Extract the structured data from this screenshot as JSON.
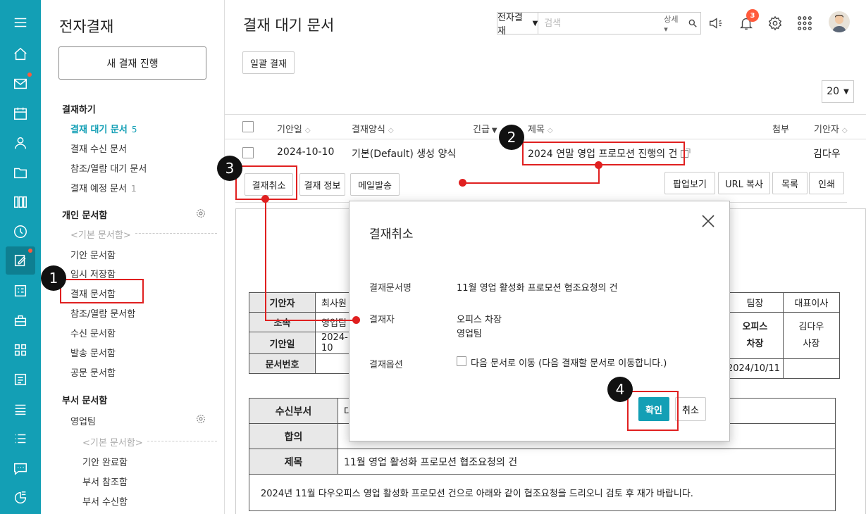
{
  "sidebar": {
    "title": "전자결재",
    "new_button": "새 결재 진행",
    "sections": {
      "approve": "결재하기",
      "personal": "개인 문서함",
      "dept": "부서 문서함"
    },
    "approve_items": [
      {
        "label": "결재 대기 문서",
        "count": "5"
      },
      {
        "label": "결재 수신 문서"
      },
      {
        "label": "참조/열람 대기 문서"
      },
      {
        "label": "결재 예정 문서",
        "count": "1"
      }
    ],
    "personal_group": "<기본 문서함>",
    "personal_items": [
      "기안 문서함",
      "임시 저장함",
      "결재 문서함",
      "참조/열람 문서함",
      "수신 문서함",
      "발송 문서함",
      "공문 문서함"
    ],
    "dept_team": "영업팀",
    "dept_group": "<기본 문서함>",
    "dept_items": [
      "기안 완료함",
      "부서 참조함",
      "부서 수신함"
    ]
  },
  "header": {
    "title": "결재 대기 문서",
    "search_scope": "전자결재",
    "search_placeholder": "검색",
    "advanced": "상세",
    "notification_count": "3"
  },
  "toolbar": {
    "bulk_approve": "일괄 결재",
    "per_page": "20"
  },
  "table": {
    "headers": {
      "date": "기안일",
      "form": "결재양식",
      "urgent": "긴급",
      "title": "제목",
      "attach": "첨부",
      "drafter": "기안자"
    },
    "row": {
      "date": "2024-10-10",
      "form": "기본(Default) 생성 양식",
      "title": "2024 연말 영업 프로모션 진행의 건",
      "drafter": "김다우"
    }
  },
  "actions": {
    "cancel_approval": "결재취소",
    "approval_info": "결재 정보",
    "send_mail": "메일발송",
    "popup": "팝업보기",
    "copy_url": "URL 복사",
    "list": "목록",
    "print": "인쇄"
  },
  "document": {
    "info_labels": [
      "기안자",
      "소속",
      "기안일",
      "문서번호"
    ],
    "info_values": [
      "최사원",
      "영업팀",
      "2024-10"
    ],
    "approval_cols": [
      "팀장",
      "대표이사"
    ],
    "approver1_line1": "오피스",
    "approver1_line2": "차장",
    "approver2_line1": "김다우",
    "approver2_line2": "사장",
    "approval_date": "2024/10/11",
    "recv_label": "수신부서",
    "recv_value": "대",
    "agree_label": "합의",
    "subject_label": "제목",
    "subject_value": "11월 영업 활성화 프로모션 협조요청의 건",
    "body": "2024년 11월 다우오피스 영업 활성화 프로모션 건으로 아래와 같이 협조요청을 드리오니 검토 후 재가 바랍니다."
  },
  "modal": {
    "title": "결재취소",
    "doc_label": "결재문서명",
    "doc_value": "11월 영업 활성화 프로모션 협조요청의 건",
    "approver_label": "결재자",
    "approver_line1": "오피스 차장",
    "approver_line2": "영업팀",
    "option_label": "결재옵션",
    "option_text": "다음 문서로 이동 (다음 결재할 문서로 이동합니다.)",
    "ok": "확인",
    "cancel": "취소"
  },
  "callouts": [
    "1",
    "2",
    "3",
    "4"
  ],
  "colors": {
    "accent": "#139fb5",
    "highlight": "#e02020",
    "badge": "#ff5a3c"
  }
}
